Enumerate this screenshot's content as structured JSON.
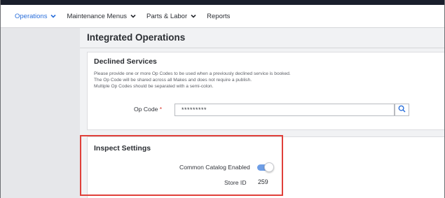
{
  "nav": {
    "items": [
      {
        "label": "Operations",
        "has_dropdown": true,
        "active": true
      },
      {
        "label": "Maintenance Menus",
        "has_dropdown": true,
        "active": false
      },
      {
        "label": "Parts & Labor",
        "has_dropdown": true,
        "active": false
      },
      {
        "label": "Reports",
        "has_dropdown": false,
        "active": false
      }
    ]
  },
  "page": {
    "title": "Integrated Operations"
  },
  "declined_services": {
    "title": "Declined Services",
    "description": [
      "Please provide one or more Op Codes to be used when a previously declined service is booked.",
      "The Op Code will be shared across all Makes and does not require a publish.",
      "Multiple Op Codes should be separated with a semi-colon."
    ],
    "op_code": {
      "label": "Op Code",
      "required_marker": "*",
      "value": "*********"
    }
  },
  "inspect_settings": {
    "title": "Inspect Settings",
    "common_catalog": {
      "label": "Common Catalog Enabled",
      "enabled": true
    },
    "store_id": {
      "label": "Store ID",
      "value": "259"
    }
  },
  "colors": {
    "accent": "#2a6fdb",
    "toggle_on": "#6e9ee6",
    "highlight": "#e0403a",
    "required": "#d9342b"
  },
  "icons": {
    "dropdown": "chevron-down-icon",
    "search": "search-icon"
  }
}
